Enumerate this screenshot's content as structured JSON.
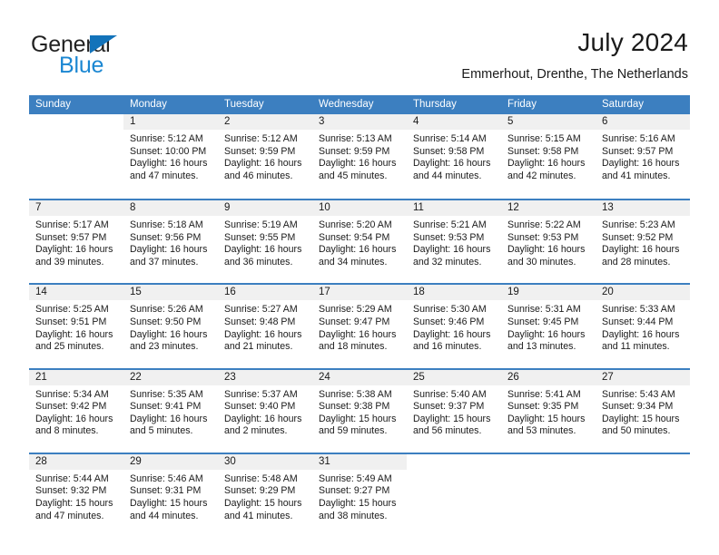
{
  "logo": {
    "word_one": "General",
    "word_two": "Blue",
    "triangle_icon": "triangle-icon",
    "brand_color": "#1b87d2"
  },
  "header": {
    "month_title": "July 2024",
    "location": "Emmerhout, Drenthe, The Netherlands"
  },
  "calendar": {
    "header_color": "#3c7fc0",
    "weekdays": [
      "Sunday",
      "Monday",
      "Tuesday",
      "Wednesday",
      "Thursday",
      "Friday",
      "Saturday"
    ],
    "weeks": [
      [
        {
          "date": "",
          "sunrise": "",
          "sunset": "",
          "daylight": "",
          "empty": true
        },
        {
          "date": "1",
          "sunrise": "Sunrise: 5:12 AM",
          "sunset": "Sunset: 10:00 PM",
          "daylight": "Daylight: 16 hours and 47 minutes."
        },
        {
          "date": "2",
          "sunrise": "Sunrise: 5:12 AM",
          "sunset": "Sunset: 9:59 PM",
          "daylight": "Daylight: 16 hours and 46 minutes."
        },
        {
          "date": "3",
          "sunrise": "Sunrise: 5:13 AM",
          "sunset": "Sunset: 9:59 PM",
          "daylight": "Daylight: 16 hours and 45 minutes."
        },
        {
          "date": "4",
          "sunrise": "Sunrise: 5:14 AM",
          "sunset": "Sunset: 9:58 PM",
          "daylight": "Daylight: 16 hours and 44 minutes."
        },
        {
          "date": "5",
          "sunrise": "Sunrise: 5:15 AM",
          "sunset": "Sunset: 9:58 PM",
          "daylight": "Daylight: 16 hours and 42 minutes."
        },
        {
          "date": "6",
          "sunrise": "Sunrise: 5:16 AM",
          "sunset": "Sunset: 9:57 PM",
          "daylight": "Daylight: 16 hours and 41 minutes."
        }
      ],
      [
        {
          "date": "7",
          "sunrise": "Sunrise: 5:17 AM",
          "sunset": "Sunset: 9:57 PM",
          "daylight": "Daylight: 16 hours and 39 minutes."
        },
        {
          "date": "8",
          "sunrise": "Sunrise: 5:18 AM",
          "sunset": "Sunset: 9:56 PM",
          "daylight": "Daylight: 16 hours and 37 minutes."
        },
        {
          "date": "9",
          "sunrise": "Sunrise: 5:19 AM",
          "sunset": "Sunset: 9:55 PM",
          "daylight": "Daylight: 16 hours and 36 minutes."
        },
        {
          "date": "10",
          "sunrise": "Sunrise: 5:20 AM",
          "sunset": "Sunset: 9:54 PM",
          "daylight": "Daylight: 16 hours and 34 minutes."
        },
        {
          "date": "11",
          "sunrise": "Sunrise: 5:21 AM",
          "sunset": "Sunset: 9:53 PM",
          "daylight": "Daylight: 16 hours and 32 minutes."
        },
        {
          "date": "12",
          "sunrise": "Sunrise: 5:22 AM",
          "sunset": "Sunset: 9:53 PM",
          "daylight": "Daylight: 16 hours and 30 minutes."
        },
        {
          "date": "13",
          "sunrise": "Sunrise: 5:23 AM",
          "sunset": "Sunset: 9:52 PM",
          "daylight": "Daylight: 16 hours and 28 minutes."
        }
      ],
      [
        {
          "date": "14",
          "sunrise": "Sunrise: 5:25 AM",
          "sunset": "Sunset: 9:51 PM",
          "daylight": "Daylight: 16 hours and 25 minutes."
        },
        {
          "date": "15",
          "sunrise": "Sunrise: 5:26 AM",
          "sunset": "Sunset: 9:50 PM",
          "daylight": "Daylight: 16 hours and 23 minutes."
        },
        {
          "date": "16",
          "sunrise": "Sunrise: 5:27 AM",
          "sunset": "Sunset: 9:48 PM",
          "daylight": "Daylight: 16 hours and 21 minutes."
        },
        {
          "date": "17",
          "sunrise": "Sunrise: 5:29 AM",
          "sunset": "Sunset: 9:47 PM",
          "daylight": "Daylight: 16 hours and 18 minutes."
        },
        {
          "date": "18",
          "sunrise": "Sunrise: 5:30 AM",
          "sunset": "Sunset: 9:46 PM",
          "daylight": "Daylight: 16 hours and 16 minutes."
        },
        {
          "date": "19",
          "sunrise": "Sunrise: 5:31 AM",
          "sunset": "Sunset: 9:45 PM",
          "daylight": "Daylight: 16 hours and 13 minutes."
        },
        {
          "date": "20",
          "sunrise": "Sunrise: 5:33 AM",
          "sunset": "Sunset: 9:44 PM",
          "daylight": "Daylight: 16 hours and 11 minutes."
        }
      ],
      [
        {
          "date": "21",
          "sunrise": "Sunrise: 5:34 AM",
          "sunset": "Sunset: 9:42 PM",
          "daylight": "Daylight: 16 hours and 8 minutes."
        },
        {
          "date": "22",
          "sunrise": "Sunrise: 5:35 AM",
          "sunset": "Sunset: 9:41 PM",
          "daylight": "Daylight: 16 hours and 5 minutes."
        },
        {
          "date": "23",
          "sunrise": "Sunrise: 5:37 AM",
          "sunset": "Sunset: 9:40 PM",
          "daylight": "Daylight: 16 hours and 2 minutes."
        },
        {
          "date": "24",
          "sunrise": "Sunrise: 5:38 AM",
          "sunset": "Sunset: 9:38 PM",
          "daylight": "Daylight: 15 hours and 59 minutes."
        },
        {
          "date": "25",
          "sunrise": "Sunrise: 5:40 AM",
          "sunset": "Sunset: 9:37 PM",
          "daylight": "Daylight: 15 hours and 56 minutes."
        },
        {
          "date": "26",
          "sunrise": "Sunrise: 5:41 AM",
          "sunset": "Sunset: 9:35 PM",
          "daylight": "Daylight: 15 hours and 53 minutes."
        },
        {
          "date": "27",
          "sunrise": "Sunrise: 5:43 AM",
          "sunset": "Sunset: 9:34 PM",
          "daylight": "Daylight: 15 hours and 50 minutes."
        }
      ],
      [
        {
          "date": "28",
          "sunrise": "Sunrise: 5:44 AM",
          "sunset": "Sunset: 9:32 PM",
          "daylight": "Daylight: 15 hours and 47 minutes."
        },
        {
          "date": "29",
          "sunrise": "Sunrise: 5:46 AM",
          "sunset": "Sunset: 9:31 PM",
          "daylight": "Daylight: 15 hours and 44 minutes."
        },
        {
          "date": "30",
          "sunrise": "Sunrise: 5:48 AM",
          "sunset": "Sunset: 9:29 PM",
          "daylight": "Daylight: 15 hours and 41 minutes."
        },
        {
          "date": "31",
          "sunrise": "Sunrise: 5:49 AM",
          "sunset": "Sunset: 9:27 PM",
          "daylight": "Daylight: 15 hours and 38 minutes."
        },
        {
          "date": "",
          "sunrise": "",
          "sunset": "",
          "daylight": "",
          "empty": true
        },
        {
          "date": "",
          "sunrise": "",
          "sunset": "",
          "daylight": "",
          "empty": true
        },
        {
          "date": "",
          "sunrise": "",
          "sunset": "",
          "daylight": "",
          "empty": true
        }
      ]
    ]
  }
}
